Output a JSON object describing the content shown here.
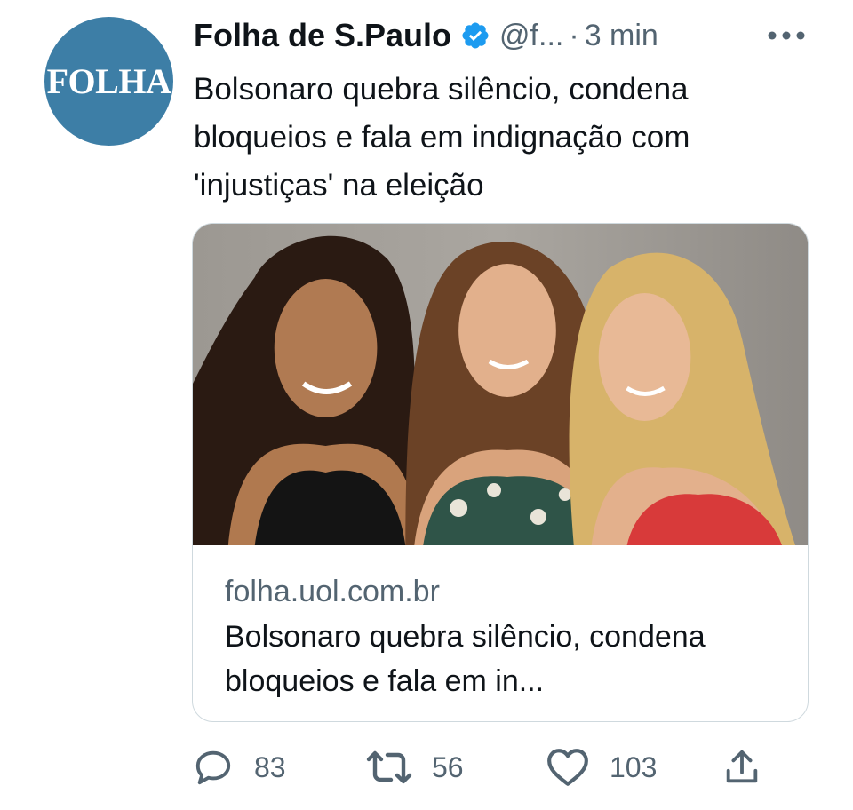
{
  "tweet": {
    "avatar_text": "FOLHA",
    "author_name": "Folha de S.Paulo",
    "handle": "@f...",
    "separator": "·",
    "time": "3 min",
    "text": "Bolsonaro quebra silêncio, condena bloqueios e fala em indignação com 'injustiças' na eleição"
  },
  "card": {
    "domain": "folha.uol.com.br",
    "title": "Bolsonaro quebra silêncio, condena bloqueios e fala em in..."
  },
  "actions": {
    "replies": "83",
    "retweets": "56",
    "likes": "103"
  },
  "colors": {
    "avatar_bg": "#3d7ea6",
    "verified": "#1d9bf0",
    "secondary_text": "#536471",
    "border": "#cfd9de"
  },
  "icons": {
    "verified": "verified-badge-icon",
    "more": "more-horizontal-icon",
    "reply": "reply-icon",
    "retweet": "retweet-icon",
    "like": "heart-icon",
    "share": "share-icon"
  }
}
